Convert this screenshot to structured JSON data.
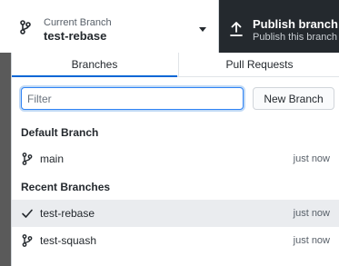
{
  "toolbar": {
    "branch": {
      "caption": "Current Branch",
      "value": "test-rebase",
      "icon": "git-branch-icon"
    },
    "publish": {
      "title": "Publish branch",
      "subtitle": "Publish this branch",
      "icon": "upload-icon"
    }
  },
  "popup": {
    "tabs": [
      {
        "label": "Branches",
        "selected": true
      },
      {
        "label": "Pull Requests",
        "selected": false
      }
    ],
    "filter": {
      "placeholder": "Filter",
      "value": ""
    },
    "new_branch_label": "New Branch",
    "default_section": {
      "title": "Default Branch",
      "items": [
        {
          "name": "main",
          "time": "just now",
          "icon": "git-branch-icon",
          "current": false
        }
      ]
    },
    "recent_section": {
      "title": "Recent Branches",
      "items": [
        {
          "name": "test-rebase",
          "time": "just now",
          "icon": "check-icon",
          "current": true
        },
        {
          "name": "test-squash",
          "time": "just now",
          "icon": "git-branch-icon",
          "current": false
        }
      ]
    }
  },
  "colors": {
    "accent": "#0366d6",
    "toolbar_dark": "#24292e",
    "selected_row": "#eaecef"
  }
}
